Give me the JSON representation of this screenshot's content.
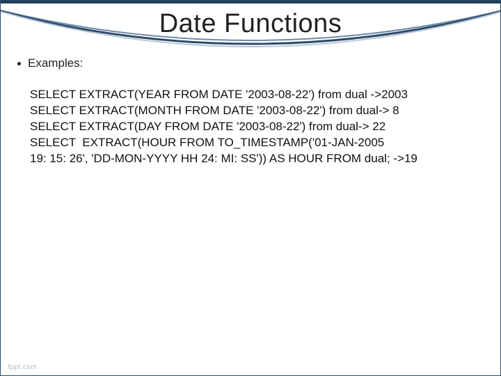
{
  "title": "Date Functions",
  "bullet_label": "Examples:",
  "examples": "SELECT EXTRACT(YEAR FROM DATE '2003-08-22') from dual ->2003\nSELECT EXTRACT(MONTH FROM DATE '2003-08-22') from dual-> 8\nSELECT EXTRACT(DAY FROM DATE '2003-08-22') from dual-> 22\nSELECT  EXTRACT(HOUR FROM TO_TIMESTAMP('01-JAN-2005\n19: 15: 26', 'DD-MON-YYYY HH 24: MI: SS')) AS HOUR FROM dual; ->19",
  "footer": "fppt.com"
}
